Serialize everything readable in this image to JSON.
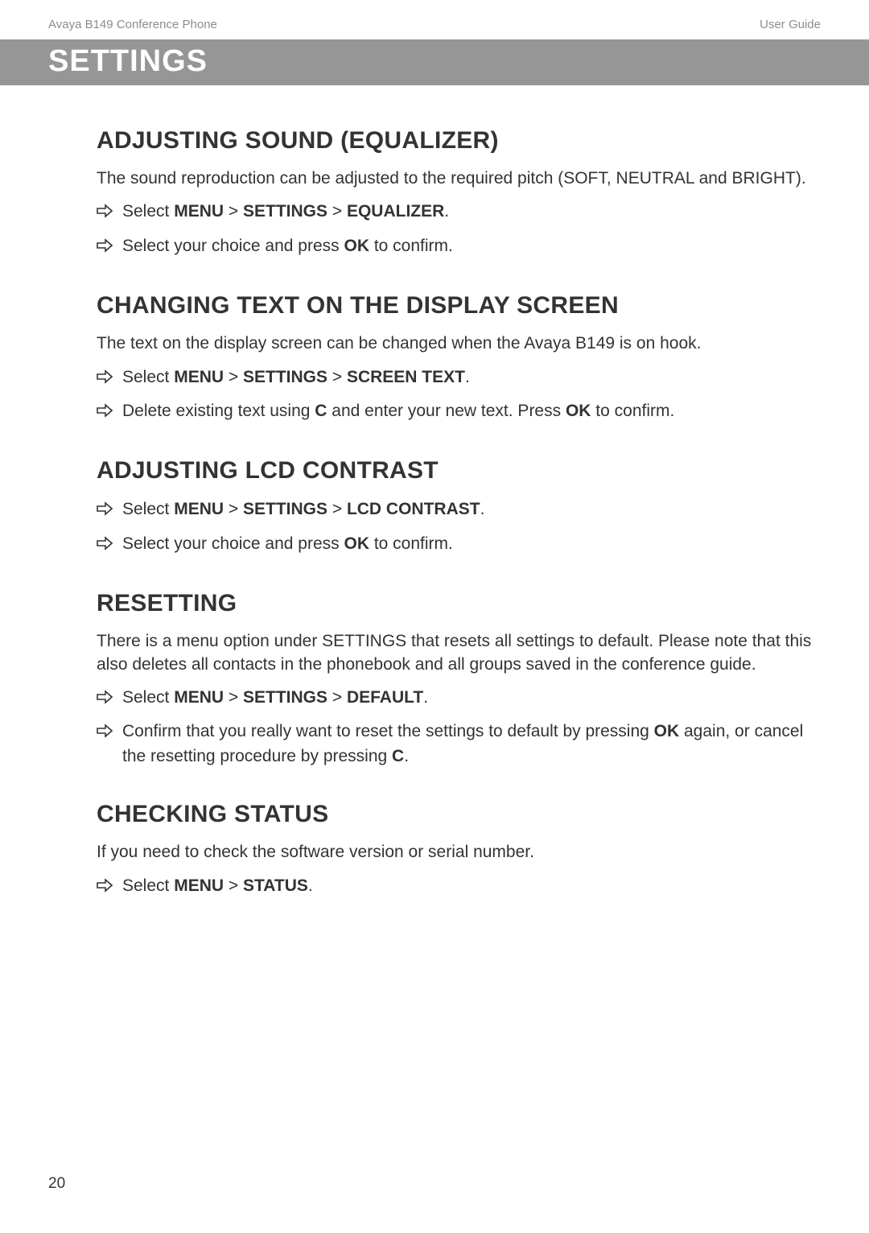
{
  "header": {
    "left": "Avaya B149 Conference Phone",
    "right": "User Guide"
  },
  "banner": "SETTINGS",
  "sections": {
    "equalizer": {
      "title": "ADJUSTING SOUND (EQUALIZER)",
      "intro": "The sound reproduction can be adjusted to the required pitch (SOFT, NEUTRAL and BRIGHT).",
      "step1_select": "Select ",
      "step1_menu": "MENU",
      "step1_gt1": " > ",
      "step1_settings": "SETTINGS",
      "step1_gt2": " > ",
      "step1_equalizer": "EQUALIZER",
      "step1_dot": ".",
      "step2_pre": "Select your choice and press ",
      "step2_ok": "OK",
      "step2_post": " to confirm."
    },
    "screentext": {
      "title": "CHANGING TEXT ON THE DISPLAY SCREEN",
      "intro": "The text on the display screen can be changed when the Avaya B149 is on hook.",
      "step1_select": "Select ",
      "step1_menu": "MENU",
      "step1_gt1": " > ",
      "step1_settings": "SETTINGS",
      "step1_gt2": " > ",
      "step1_screen": "SCREEN TEXT",
      "step1_dot": ".",
      "step2_pre": "Delete existing text using ",
      "step2_c": "C",
      "step2_mid": " and enter your new text. Press ",
      "step2_ok": "OK",
      "step2_post": " to confirm."
    },
    "lcd": {
      "title": "ADJUSTING LCD CONTRAST",
      "step1_select": "Select ",
      "step1_menu": "MENU",
      "step1_gt1": " > ",
      "step1_settings": "SETTINGS",
      "step1_gt2": " > ",
      "step1_lcd": "LCD CONTRAST",
      "step1_dot": ".",
      "step2_pre": "Select your choice and press ",
      "step2_ok": "OK",
      "step2_post": " to confirm."
    },
    "reset": {
      "title": "RESETTING",
      "intro": "There is a menu option under SETTINGS that resets all settings to default. Please note that this also deletes all contacts in the phonebook and all groups saved in the conference guide.",
      "step1_select": "Select ",
      "step1_menu": "MENU",
      "step1_gt1": " > ",
      "step1_settings": "SETTINGS",
      "step1_gt2": " > ",
      "step1_default": "DEFAULT",
      "step1_dot": ".",
      "step2_pre": "Confirm that you really want to reset the settings to default by pressing ",
      "step2_ok": "OK",
      "step2_mid": " again, or cancel the resetting procedure by pressing ",
      "step2_c": "C",
      "step2_post": "."
    },
    "status": {
      "title": "CHECKING STATUS",
      "intro": "If you need to check the software version or serial number.",
      "step1_select": "Select ",
      "step1_menu": "MENU",
      "step1_gt1": " > ",
      "step1_status": "STATUS",
      "step1_dot": "."
    }
  },
  "page_number": "20"
}
